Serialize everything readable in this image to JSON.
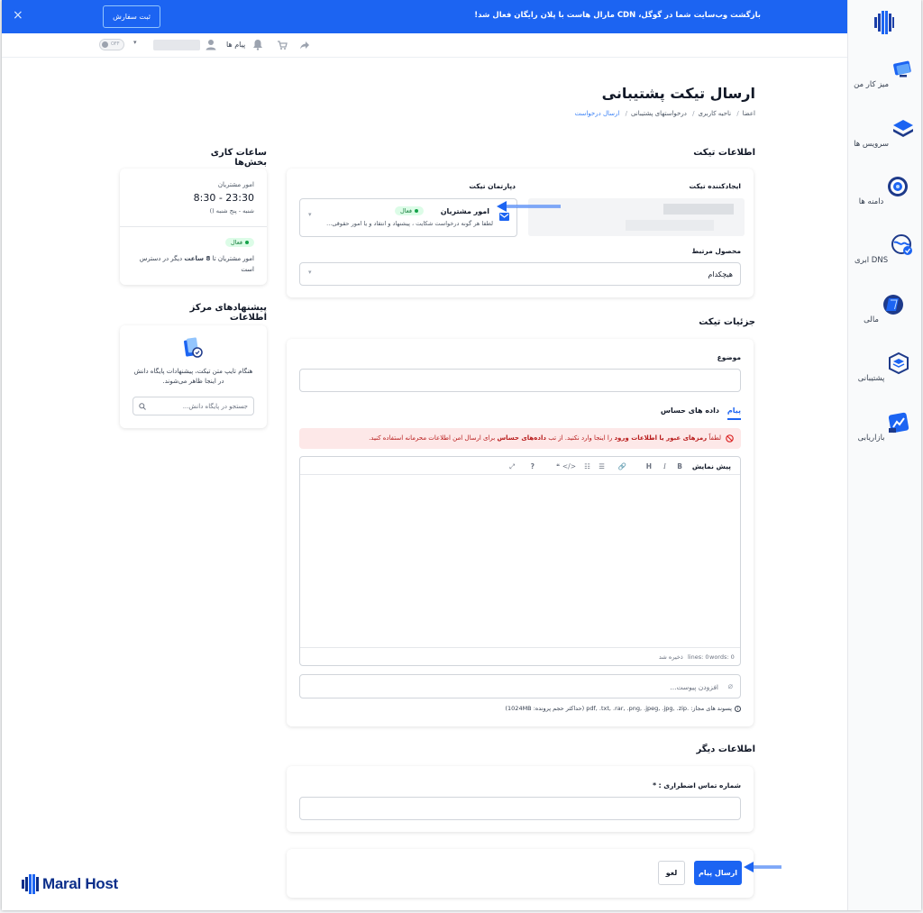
{
  "banner": {
    "text": "بازگشت وب‌سایت شما در گوگل، CDN مارال هاست با پلان رایگان فعال شد!",
    "button_label": "ثبت سفارش",
    "close_icon": "×"
  },
  "topbar": {
    "messages_label": "پیام ها",
    "toggle_label": "OFF"
  },
  "sidebar": {
    "items": [
      {
        "label": "میز کار من",
        "icon": "desktop-icon"
      },
      {
        "label": "سرویس ها",
        "icon": "layers-icon"
      },
      {
        "label": "دامنه ها",
        "icon": "globe-icon"
      },
      {
        "label": "DNS ابری",
        "icon": "dns-icon"
      },
      {
        "label": "مالی",
        "icon": "wallet-icon"
      },
      {
        "label": "پشتیبانی",
        "icon": "support-icon"
      },
      {
        "label": "بازاریابی",
        "icon": "marketing-icon"
      }
    ]
  },
  "page": {
    "title": "ارسال تیکت پشتیبانی",
    "breadcrumb": [
      "اعضا",
      "ناحیه کاربری",
      "درخواستهای پشتیبانی",
      "ارسال درخواست"
    ]
  },
  "ticket_info": {
    "title": "اطلاعات تیکت",
    "creator_label": "ایجادکننده تیکت",
    "department_label": "دپارتمان تیکت",
    "department": {
      "name": "امور مشتریان",
      "status": "فعال",
      "description": "لطفا هر گونه درخواست شکایت ، پیشنهاد و انتقاد و یا امور حقوقی..."
    },
    "product_label": "محصول مرتبط",
    "product_value": "هیچکدام"
  },
  "ticket_details": {
    "title": "جزئیات تیکت",
    "subject_label": "موضوع",
    "tabs": [
      "پیام",
      "داده های حساس"
    ],
    "alert": {
      "prefix": "لطفاً ",
      "bold1": "رمزهای عبور یا اطلاعات ورود",
      "mid": " را اینجا وارد نکنید. از تب ",
      "bold2": "داده‌های حساس",
      "suffix": " برای ارسال امن اطلاعات محرمانه استفاده کنید."
    },
    "editor": {
      "preview_label": "پیش نمایش",
      "toolbar": [
        "B",
        "I",
        "H",
        "🔗",
        "☰",
        "☷",
        "</>",
        "❝",
        "?",
        "⤢"
      ],
      "status_lines": "lines: 0",
      "status_words": "words: 0",
      "status_saved": "ذخیره شد"
    },
    "attachment_placeholder": "افزودن پیوست...",
    "allowed_ext": "پسوند های مجاز: .pdf, .txt, .rar, .png, .jpeg, .jpg, .zip (حداکثر حجم پرونده: 1024MB)"
  },
  "other_info": {
    "title": "اطلاعات دیگر",
    "phone_label": "شماره تماس اضطراری : *"
  },
  "actions": {
    "submit_label": "ارسال پیام",
    "cancel_label": "لغو"
  },
  "working_hours": {
    "title": "ساعات کاری بخش‌ها",
    "department": "امور مشتریان",
    "hours": "8:30 - 23:30",
    "days": "شنبه - پنج شنبه ()",
    "status": "فعال",
    "availability_prefix": "امور مشتریان تا ",
    "availability_hours": "8",
    "availability_unit": " ساعت",
    "availability_suffix": " دیگر در دسترس است"
  },
  "kb": {
    "title": "پیشنهادهای مرکز اطلاعات",
    "text": "هنگام تایپ متن تیکت، پیشنهادات پایگاه دانش در اینجا ظاهر می‌شوند.",
    "search_placeholder": "جستجو در پایگاه دانش..."
  },
  "brand": {
    "name": "Maral Host",
    "accent": "#1c64f2",
    "dark": "#0b2e8a"
  }
}
